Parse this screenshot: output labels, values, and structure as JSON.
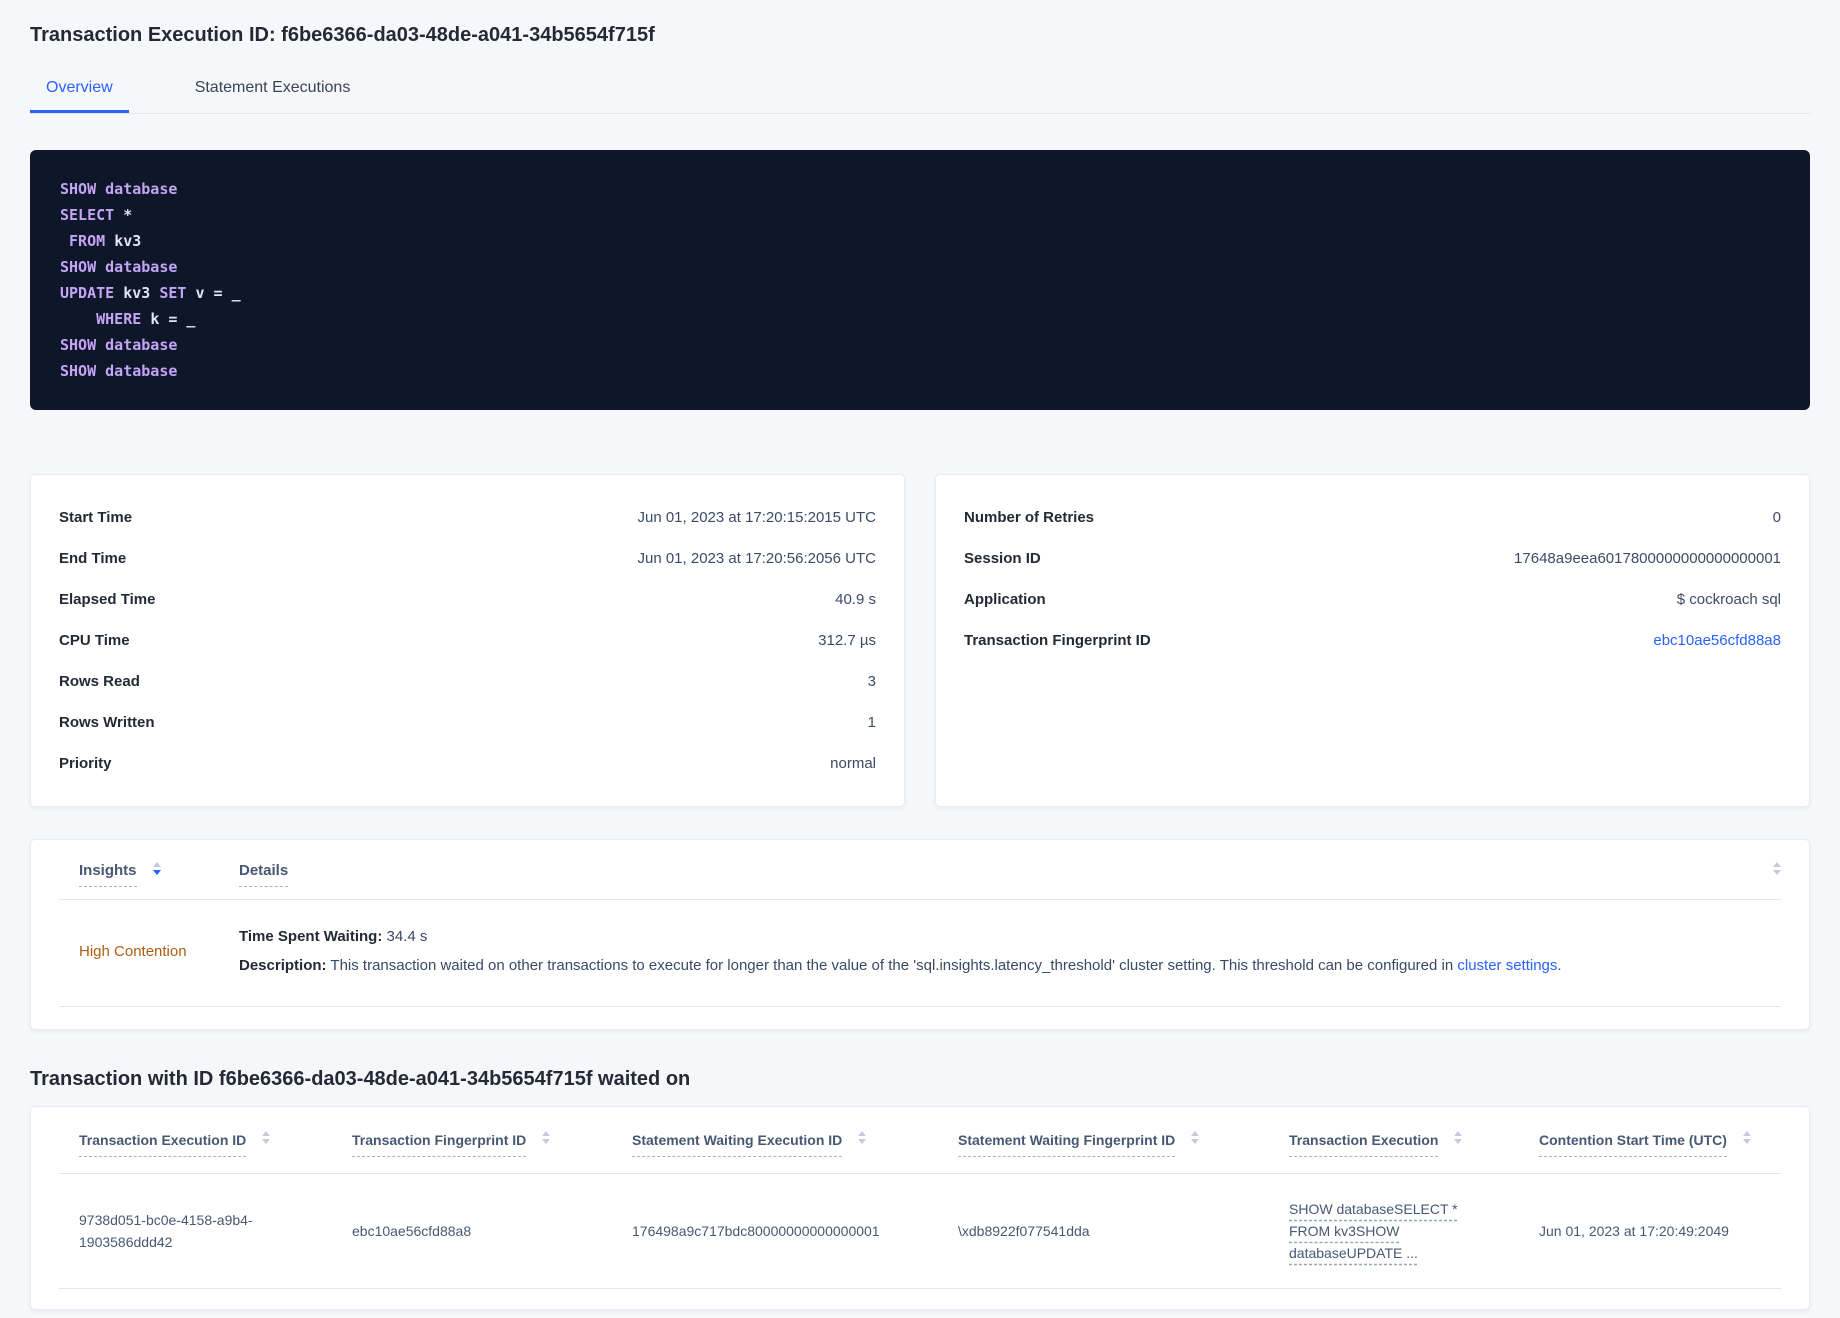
{
  "page_title": "Transaction Execution ID: f6be6366-da03-48de-a041-34b5654f715f",
  "tabs": {
    "overview": "Overview",
    "statement_executions": "Statement Executions"
  },
  "sql_box": {
    "lines": [
      [
        {
          "text": "SHOW database",
          "kw": true
        }
      ],
      [
        {
          "text": "SELECT ",
          "kw": true
        },
        {
          "text": "*",
          "kw": false
        }
      ],
      [
        {
          "text": " ",
          "kw": false
        },
        {
          "text": "FROM ",
          "kw": true
        },
        {
          "text": "kv3",
          "kw": false
        }
      ],
      [
        {
          "text": "SHOW database",
          "kw": true
        }
      ],
      [
        {
          "text": "UPDATE ",
          "kw": true
        },
        {
          "text": "kv3 ",
          "kw": false
        },
        {
          "text": "SET ",
          "kw": true
        },
        {
          "text": "v = _",
          "kw": false
        }
      ],
      [
        {
          "text": "    ",
          "kw": false
        },
        {
          "text": "WHERE ",
          "kw": true
        },
        {
          "text": "k = _",
          "kw": false
        }
      ],
      [
        {
          "text": "SHOW database",
          "kw": true
        }
      ],
      [
        {
          "text": "SHOW database",
          "kw": true
        }
      ]
    ]
  },
  "summary_left": {
    "rows": [
      {
        "label": "Start Time",
        "value": "Jun 01, 2023 at 17:20:15:2015 UTC"
      },
      {
        "label": "End Time",
        "value": "Jun 01, 2023 at 17:20:56:2056 UTC"
      },
      {
        "label": "Elapsed Time",
        "value": "40.9 s"
      },
      {
        "label": "CPU Time",
        "value": "312.7 µs"
      },
      {
        "label": "Rows Read",
        "value": "3"
      },
      {
        "label": "Rows Written",
        "value": "1"
      },
      {
        "label": "Priority",
        "value": "normal"
      }
    ]
  },
  "summary_right": {
    "rows": [
      {
        "label": "Number of Retries",
        "value": "0"
      },
      {
        "label": "Session ID",
        "value": "17648a9eea6017800000000000000001"
      },
      {
        "label": "Application",
        "value": "$ cockroach sql"
      },
      {
        "label": "Transaction Fingerprint ID",
        "value": "ebc10ae56cfd88a8",
        "link": true
      }
    ]
  },
  "insights_table": {
    "insights_col": "Insights",
    "details_col": "Details",
    "row": {
      "insight": "High Contention",
      "waiting_label": "Time Spent Waiting:",
      "waiting_value": " 34.4 s",
      "description_label": "Description:",
      "description_text": " This transaction waited on other transactions to execute for longer than the value of the 'sql.insights.latency_threshold' cluster setting. This threshold can be configured in ",
      "description_link": "cluster settings",
      "description_suffix": "."
    }
  },
  "waited_on": {
    "heading": "Transaction with ID f6be6366-da03-48de-a041-34b5654f715f waited on",
    "columns": [
      "Transaction Execution ID",
      "Transaction Fingerprint ID",
      "Statement Waiting Execution ID",
      "Statement Waiting Fingerprint ID",
      "Transaction Execution",
      "Contention Start Time (UTC)"
    ],
    "row": {
      "transaction_execution_id": "9738d051-bc0e-4158-a9b4-1903586ddd42",
      "transaction_fingerprint_id": "ebc10ae56cfd88a8",
      "statement_waiting_execution_id": "176498a9c717bdc80000000000000001",
      "statement_waiting_fingerprint_id": "\\xdb8922f077541dda",
      "transaction_execution": "SHOW databaseSELECT * FROM kv3SHOW databaseUPDATE ...",
      "contention_start_time": "Jun 01, 2023 at 17:20:49:2049"
    }
  },
  "colors": {
    "accent": "#2962ff",
    "warning_orange": "#ad5f11",
    "sql_background": "#0e1729",
    "sql_keyword": "#c5a3f5",
    "sql_text": "#e4e2f7"
  }
}
